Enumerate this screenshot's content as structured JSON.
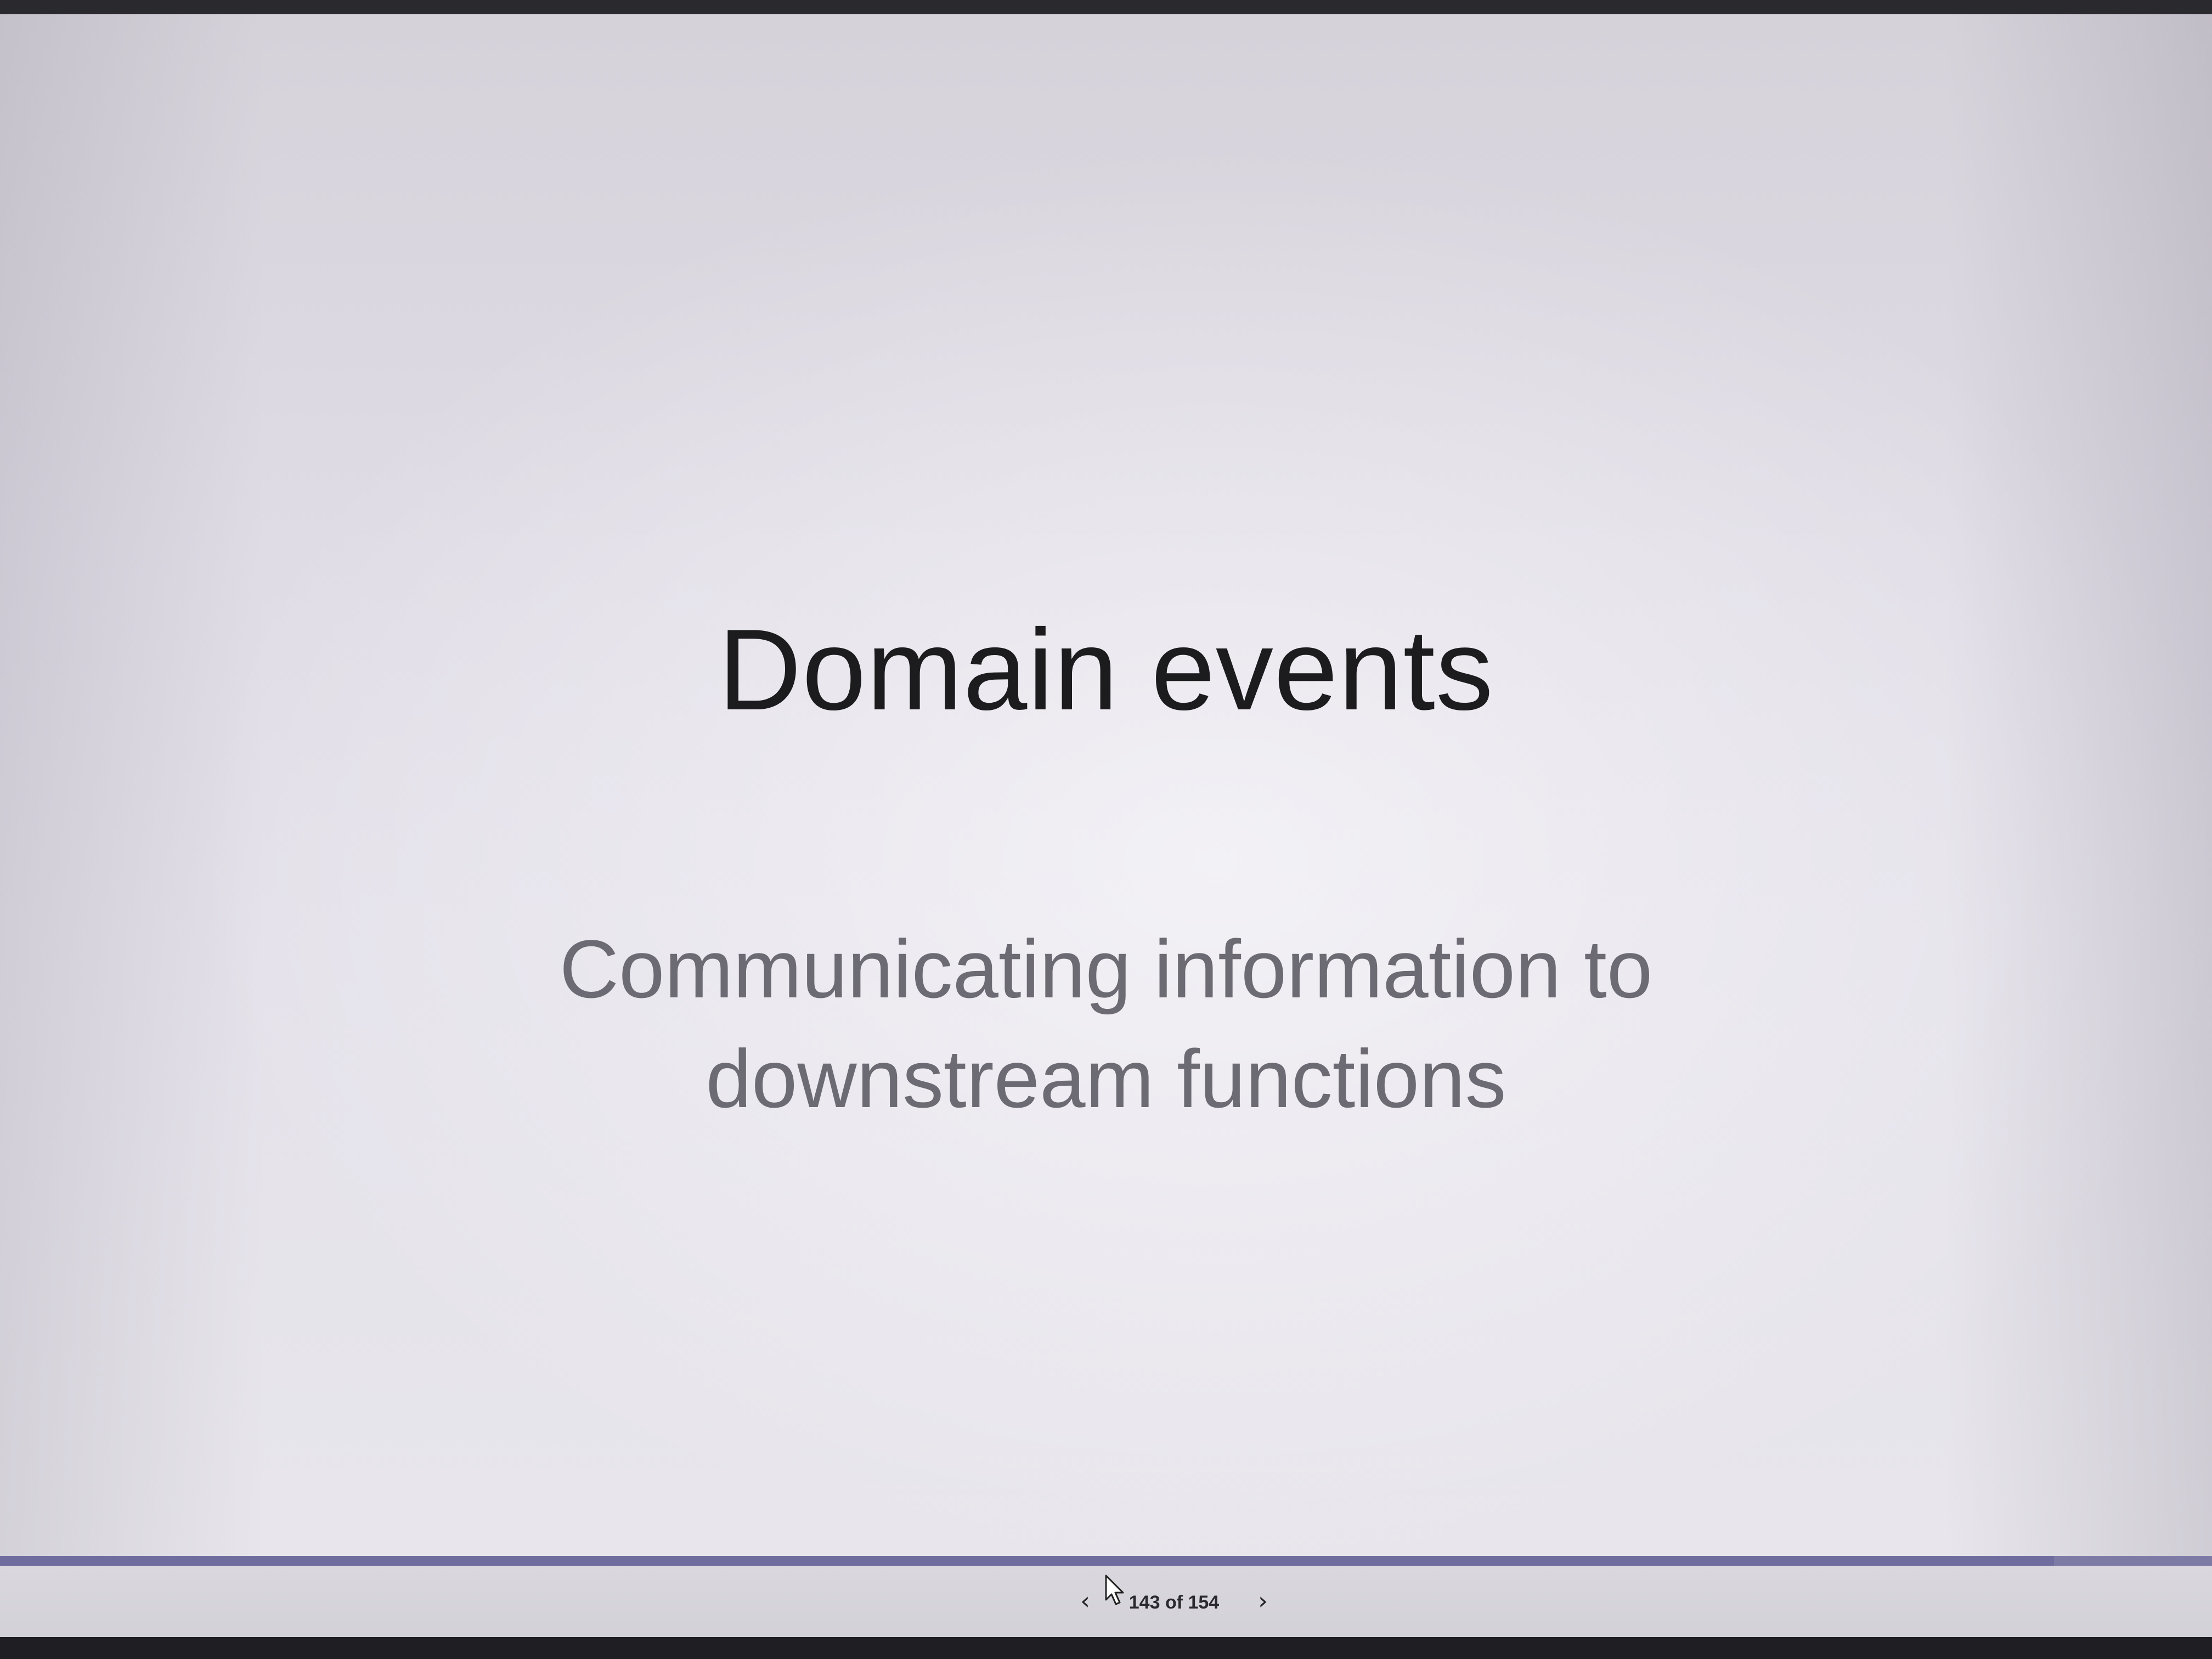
{
  "slide": {
    "title": "Domain events",
    "subtitle_lines": [
      "Communicating information to",
      "downstream functions"
    ]
  },
  "navigation": {
    "prev_icon": "chevron-left-icon",
    "next_icon": "chevron-right-icon",
    "page_counter": "143 of 154",
    "progress_fraction": 0.9286
  },
  "colors": {
    "progress": "#7d7ba6",
    "title_text": "#1c1b1d",
    "subtitle_text": "#6c6a72"
  }
}
